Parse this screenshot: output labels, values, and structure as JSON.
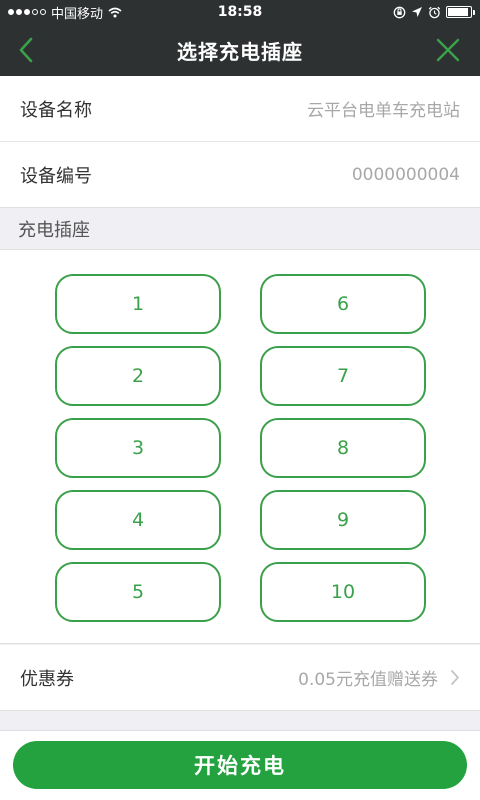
{
  "status_bar": {
    "carrier": "中国移动",
    "time": "18:58",
    "signal_bars_filled": 3,
    "signal_bars_total": 5,
    "battery_level": 0.9
  },
  "nav": {
    "title": "选择充电插座",
    "back_icon": "chevron-left-icon",
    "close_icon": "close-icon",
    "icon_color": "#3aa14a"
  },
  "device": {
    "name_label": "设备名称",
    "name_value": "云平台电单车充电站",
    "code_label": "设备编号",
    "code_value": "0000000004"
  },
  "sockets": {
    "section_title": "充电插座",
    "left_column": [
      "1",
      "2",
      "3",
      "4",
      "5"
    ],
    "right_column": [
      "6",
      "7",
      "8",
      "9",
      "10"
    ],
    "accent_color": "#3aa14a"
  },
  "coupon": {
    "label": "优惠券",
    "value": "0.05元充值赠送券"
  },
  "actions": {
    "start_label": "开始充电",
    "start_color": "#24a240"
  }
}
